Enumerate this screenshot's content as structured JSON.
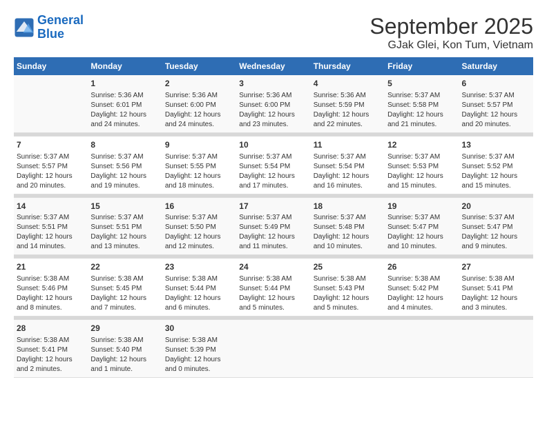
{
  "header": {
    "logo_line1": "General",
    "logo_line2": "Blue",
    "title": "September 2025",
    "subtitle": "GJak Glei, Kon Tum, Vietnam"
  },
  "weekdays": [
    "Sunday",
    "Monday",
    "Tuesday",
    "Wednesday",
    "Thursday",
    "Friday",
    "Saturday"
  ],
  "weeks": [
    [
      {
        "day": "",
        "sunrise": "",
        "sunset": "",
        "daylight": ""
      },
      {
        "day": "1",
        "sunrise": "Sunrise: 5:36 AM",
        "sunset": "Sunset: 6:01 PM",
        "daylight": "Daylight: 12 hours and 24 minutes."
      },
      {
        "day": "2",
        "sunrise": "Sunrise: 5:36 AM",
        "sunset": "Sunset: 6:00 PM",
        "daylight": "Daylight: 12 hours and 24 minutes."
      },
      {
        "day": "3",
        "sunrise": "Sunrise: 5:36 AM",
        "sunset": "Sunset: 6:00 PM",
        "daylight": "Daylight: 12 hours and 23 minutes."
      },
      {
        "day": "4",
        "sunrise": "Sunrise: 5:36 AM",
        "sunset": "Sunset: 5:59 PM",
        "daylight": "Daylight: 12 hours and 22 minutes."
      },
      {
        "day": "5",
        "sunrise": "Sunrise: 5:37 AM",
        "sunset": "Sunset: 5:58 PM",
        "daylight": "Daylight: 12 hours and 21 minutes."
      },
      {
        "day": "6",
        "sunrise": "Sunrise: 5:37 AM",
        "sunset": "Sunset: 5:57 PM",
        "daylight": "Daylight: 12 hours and 20 minutes."
      }
    ],
    [
      {
        "day": "7",
        "sunrise": "Sunrise: 5:37 AM",
        "sunset": "Sunset: 5:57 PM",
        "daylight": "Daylight: 12 hours and 20 minutes."
      },
      {
        "day": "8",
        "sunrise": "Sunrise: 5:37 AM",
        "sunset": "Sunset: 5:56 PM",
        "daylight": "Daylight: 12 hours and 19 minutes."
      },
      {
        "day": "9",
        "sunrise": "Sunrise: 5:37 AM",
        "sunset": "Sunset: 5:55 PM",
        "daylight": "Daylight: 12 hours and 18 minutes."
      },
      {
        "day": "10",
        "sunrise": "Sunrise: 5:37 AM",
        "sunset": "Sunset: 5:54 PM",
        "daylight": "Daylight: 12 hours and 17 minutes."
      },
      {
        "day": "11",
        "sunrise": "Sunrise: 5:37 AM",
        "sunset": "Sunset: 5:54 PM",
        "daylight": "Daylight: 12 hours and 16 minutes."
      },
      {
        "day": "12",
        "sunrise": "Sunrise: 5:37 AM",
        "sunset": "Sunset: 5:53 PM",
        "daylight": "Daylight: 12 hours and 15 minutes."
      },
      {
        "day": "13",
        "sunrise": "Sunrise: 5:37 AM",
        "sunset": "Sunset: 5:52 PM",
        "daylight": "Daylight: 12 hours and 15 minutes."
      }
    ],
    [
      {
        "day": "14",
        "sunrise": "Sunrise: 5:37 AM",
        "sunset": "Sunset: 5:51 PM",
        "daylight": "Daylight: 12 hours and 14 minutes."
      },
      {
        "day": "15",
        "sunrise": "Sunrise: 5:37 AM",
        "sunset": "Sunset: 5:51 PM",
        "daylight": "Daylight: 12 hours and 13 minutes."
      },
      {
        "day": "16",
        "sunrise": "Sunrise: 5:37 AM",
        "sunset": "Sunset: 5:50 PM",
        "daylight": "Daylight: 12 hours and 12 minutes."
      },
      {
        "day": "17",
        "sunrise": "Sunrise: 5:37 AM",
        "sunset": "Sunset: 5:49 PM",
        "daylight": "Daylight: 12 hours and 11 minutes."
      },
      {
        "day": "18",
        "sunrise": "Sunrise: 5:37 AM",
        "sunset": "Sunset: 5:48 PM",
        "daylight": "Daylight: 12 hours and 10 minutes."
      },
      {
        "day": "19",
        "sunrise": "Sunrise: 5:37 AM",
        "sunset": "Sunset: 5:47 PM",
        "daylight": "Daylight: 12 hours and 10 minutes."
      },
      {
        "day": "20",
        "sunrise": "Sunrise: 5:37 AM",
        "sunset": "Sunset: 5:47 PM",
        "daylight": "Daylight: 12 hours and 9 minutes."
      }
    ],
    [
      {
        "day": "21",
        "sunrise": "Sunrise: 5:38 AM",
        "sunset": "Sunset: 5:46 PM",
        "daylight": "Daylight: 12 hours and 8 minutes."
      },
      {
        "day": "22",
        "sunrise": "Sunrise: 5:38 AM",
        "sunset": "Sunset: 5:45 PM",
        "daylight": "Daylight: 12 hours and 7 minutes."
      },
      {
        "day": "23",
        "sunrise": "Sunrise: 5:38 AM",
        "sunset": "Sunset: 5:44 PM",
        "daylight": "Daylight: 12 hours and 6 minutes."
      },
      {
        "day": "24",
        "sunrise": "Sunrise: 5:38 AM",
        "sunset": "Sunset: 5:44 PM",
        "daylight": "Daylight: 12 hours and 5 minutes."
      },
      {
        "day": "25",
        "sunrise": "Sunrise: 5:38 AM",
        "sunset": "Sunset: 5:43 PM",
        "daylight": "Daylight: 12 hours and 5 minutes."
      },
      {
        "day": "26",
        "sunrise": "Sunrise: 5:38 AM",
        "sunset": "Sunset: 5:42 PM",
        "daylight": "Daylight: 12 hours and 4 minutes."
      },
      {
        "day": "27",
        "sunrise": "Sunrise: 5:38 AM",
        "sunset": "Sunset: 5:41 PM",
        "daylight": "Daylight: 12 hours and 3 minutes."
      }
    ],
    [
      {
        "day": "28",
        "sunrise": "Sunrise: 5:38 AM",
        "sunset": "Sunset: 5:41 PM",
        "daylight": "Daylight: 12 hours and 2 minutes."
      },
      {
        "day": "29",
        "sunrise": "Sunrise: 5:38 AM",
        "sunset": "Sunset: 5:40 PM",
        "daylight": "Daylight: 12 hours and 1 minute."
      },
      {
        "day": "30",
        "sunrise": "Sunrise: 5:38 AM",
        "sunset": "Sunset: 5:39 PM",
        "daylight": "Daylight: 12 hours and 0 minutes."
      },
      {
        "day": "",
        "sunrise": "",
        "sunset": "",
        "daylight": ""
      },
      {
        "day": "",
        "sunrise": "",
        "sunset": "",
        "daylight": ""
      },
      {
        "day": "",
        "sunrise": "",
        "sunset": "",
        "daylight": ""
      },
      {
        "day": "",
        "sunrise": "",
        "sunset": "",
        "daylight": ""
      }
    ]
  ]
}
